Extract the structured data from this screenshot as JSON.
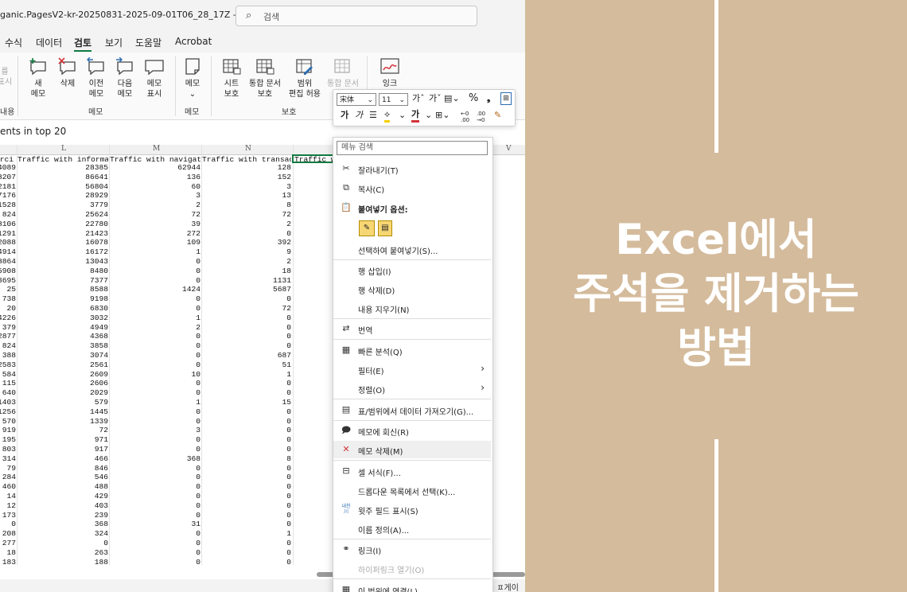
{
  "excel": {
    "title": "ganic.PagesV2-kr-20250831-2025-09-01T06_28_17Z  -  E... ∨",
    "search_placeholder": "검색",
    "menu_items": [
      "수식",
      "데이터",
      "검토",
      "보기",
      "도움말",
      "Acrobat"
    ],
    "active_menu": "검토",
    "ribbon": {
      "partial_left": {
        "top": "를",
        "mid": "표시",
        "group": "내용"
      },
      "comment_buttons": [
        {
          "line1": "새",
          "line2": "메모"
        },
        {
          "line1": "삭제",
          "line2": ""
        },
        {
          "line1": "이전",
          "line2": "메모"
        },
        {
          "line1": "다음",
          "line2": "메모"
        },
        {
          "line1": "메모",
          "line2": "표시"
        }
      ],
      "comments_group": "메모",
      "notes_button": {
        "line1": "메모",
        "line2": "⌄"
      },
      "notes_group": "메모",
      "protect_buttons": [
        {
          "line1": "시트",
          "line2": "보호"
        },
        {
          "line1": "통합 문서",
          "line2": "보호"
        },
        {
          "line1": "범위",
          "line2": "편집 허용"
        },
        {
          "line1": "통합 문서",
          "line2": "공유"
        }
      ],
      "protect_group": "보호",
      "ink_button": {
        "line1": "잉크"
      }
    },
    "formula_text": "ents in top 20",
    "col_headers": [
      "L",
      "M",
      "N",
      "V"
    ],
    "header_row": [
      "erci",
      "Traffic with informat",
      "Traffic with navigati",
      "Traffic with transact",
      "Traffic w"
    ],
    "rows": [
      [
        "4089",
        "28385",
        "62944",
        "128"
      ],
      [
        "8207",
        "86641",
        "136",
        "152"
      ],
      [
        "2181",
        "56804",
        "60",
        "3"
      ],
      [
        "7176",
        "28929",
        "3",
        "13"
      ],
      [
        "1528",
        "3779",
        "2",
        "8"
      ],
      [
        "824",
        "25624",
        "72",
        "72"
      ],
      [
        "8106",
        "22780",
        "39",
        "2"
      ],
      [
        "1291",
        "21423",
        "272",
        "0"
      ],
      [
        "2088",
        "16078",
        "109",
        "392"
      ],
      [
        "4914",
        "16172",
        "1",
        "9"
      ],
      [
        "8864",
        "13043",
        "0",
        "2"
      ],
      [
        "5908",
        "8480",
        "0",
        "18"
      ],
      [
        "3695",
        "7377",
        "0",
        "1131"
      ],
      [
        "25",
        "8588",
        "1424",
        "5687"
      ],
      [
        "738",
        "9198",
        "0",
        "0"
      ],
      [
        "20",
        "6830",
        "0",
        "72"
      ],
      [
        "4226",
        "3032",
        "1",
        "0"
      ],
      [
        "379",
        "4949",
        "2",
        "0"
      ],
      [
        "2877",
        "4368",
        "0",
        "0"
      ],
      [
        "824",
        "3858",
        "0",
        "0"
      ],
      [
        "388",
        "3074",
        "0",
        "687"
      ],
      [
        "2583",
        "2561",
        "0",
        "51"
      ],
      [
        "584",
        "2609",
        "10",
        "1"
      ],
      [
        "115",
        "2606",
        "0",
        "0"
      ],
      [
        "640",
        "2029",
        "0",
        "0"
      ],
      [
        "1403",
        "579",
        "1",
        "15"
      ],
      [
        "1256",
        "1445",
        "0",
        "0"
      ],
      [
        "570",
        "1339",
        "0",
        "0"
      ],
      [
        "919",
        "72",
        "3",
        "0"
      ],
      [
        "195",
        "971",
        "0",
        "0"
      ],
      [
        "803",
        "917",
        "0",
        "0"
      ],
      [
        "314",
        "466",
        "368",
        "8"
      ],
      [
        "79",
        "846",
        "0",
        "0"
      ],
      [
        "284",
        "546",
        "0",
        "0"
      ],
      [
        "460",
        "488",
        "0",
        "0"
      ],
      [
        "14",
        "429",
        "0",
        "0"
      ],
      [
        "12",
        "403",
        "0",
        "0"
      ],
      [
        "173",
        "239",
        "0",
        "0"
      ],
      [
        "0",
        "368",
        "31",
        "0"
      ],
      [
        "208",
        "324",
        "0",
        "1"
      ],
      [
        "277",
        "0",
        "0",
        "0"
      ],
      [
        "18",
        "263",
        "0",
        "0"
      ],
      [
        "183",
        "188",
        "0",
        "0"
      ]
    ],
    "status_right": "· ㅍ게이"
  },
  "mini_toolbar": {
    "font_name": "宋体",
    "font_size": "11",
    "increase_font": "가ˆ",
    "decrease_font": "가ˇ",
    "percent": "%",
    "comma": "❟",
    "bold": "가",
    "italic": "가",
    "font_color_glyph": "가",
    "inc_decimal": "←0 .00",
    "dec_decimal": ".00 →0"
  },
  "context_menu": {
    "search_placeholder": "메뉴 검색",
    "items": [
      {
        "label": "잘라내기(T)",
        "icon": "scissors-icon"
      },
      {
        "label": "복사(C)",
        "icon": "copy-icon"
      },
      {
        "label": "붙여넣기 옵션:",
        "icon": "paste-icon"
      },
      {
        "label": "선택하여 붙여넣기(S)...",
        "icon": ""
      },
      {
        "label": "행 삽입(I)",
        "icon": ""
      },
      {
        "label": "행 삭제(D)",
        "icon": ""
      },
      {
        "label": "내용 지우기(N)",
        "icon": ""
      },
      {
        "label": "번역",
        "icon": "translate-icon"
      },
      {
        "label": "빠른 분석(Q)",
        "icon": "quick-analysis-icon"
      },
      {
        "label": "필터(E)",
        "icon": ""
      },
      {
        "label": "정렬(O)",
        "icon": ""
      },
      {
        "label": "표/범위에서 데이터 가져오기(G)...",
        "icon": "table-icon"
      },
      {
        "label": "메모에 회신(R)",
        "icon": "reply-comment-icon"
      },
      {
        "label": "메모 삭제(M)",
        "icon": "delete-comment-icon"
      },
      {
        "label": "셀 서식(F)...",
        "icon": "format-cells-icon"
      },
      {
        "label": "드롭다운 목록에서 선택(K)...",
        "icon": ""
      },
      {
        "label": "윗주 필드 표시(S)",
        "icon": "phonetic-icon"
      },
      {
        "label": "이름 정의(A)...",
        "icon": ""
      },
      {
        "label": "링크(I)",
        "icon": "link-icon"
      },
      {
        "label": "하이퍼링크 열기(O)",
        "icon": ""
      },
      {
        "label": "이 범위에 연결(L)",
        "icon": "link-range-icon"
      }
    ],
    "phonetic_glyph": "내천\n川"
  },
  "banner": {
    "background": "#d4bb9c",
    "heading_lines": [
      "Excel에서",
      "주석을 제거하는",
      "방법"
    ]
  }
}
